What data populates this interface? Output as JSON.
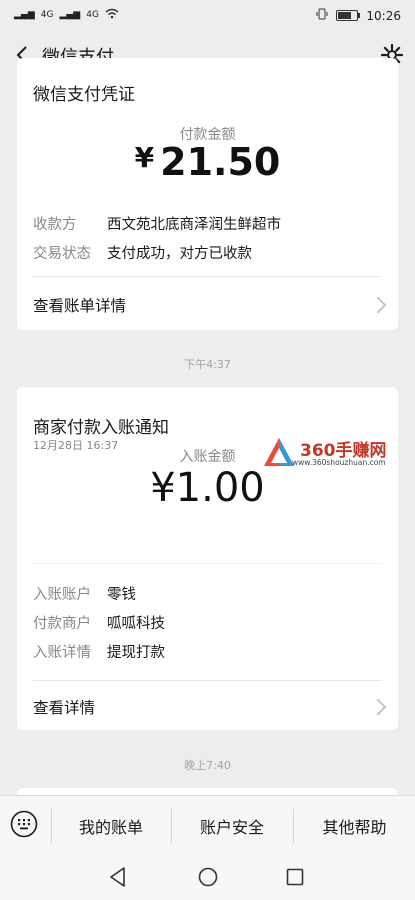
{
  "status": {
    "left_signal_1": "4G",
    "left_signal_2": "4G",
    "time": "10:26"
  },
  "nav": {
    "title": "微信支付"
  },
  "card1": {
    "title": "微信支付凭证",
    "amount_label": "付款金额",
    "amount_symbol": "¥",
    "amount": "21.50",
    "rows": [
      {
        "key": "收款方",
        "value": "西文苑北底商泽润生鲜超市"
      },
      {
        "key": "交易状态",
        "value": "支付成功，对方已收款"
      }
    ],
    "link": "查看账单详情"
  },
  "sep1": "下午4:37",
  "card2": {
    "title": "商家付款入账通知",
    "subtime": "12月28日 16:37",
    "amount_label": "入账金额",
    "amount": "¥1.00",
    "rows": [
      {
        "key": "入账账户",
        "value": "零钱"
      },
      {
        "key": "付款商户",
        "value": "呱呱科技"
      },
      {
        "key": "入账详情",
        "value": "提现打款"
      }
    ],
    "link": "查看详情"
  },
  "sep2": "晚上7:40",
  "watermark": {
    "text": "360手赚网",
    "url": "www.360shouzhuan.com"
  },
  "bottombar": {
    "tabs": [
      "我的账单",
      "账户安全",
      "其他帮助"
    ]
  },
  "colors": {
    "background": "#ededed",
    "card": "#ffffff",
    "muted": "#888888"
  }
}
